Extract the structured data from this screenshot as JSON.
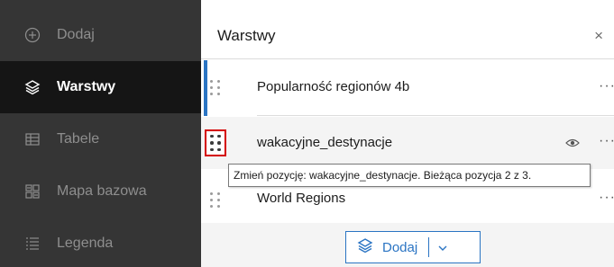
{
  "sidebar": {
    "items": [
      {
        "label": "Dodaj",
        "icon": "plus-circle-icon"
      },
      {
        "label": "Warstwy",
        "icon": "layers-icon"
      },
      {
        "label": "Tabele",
        "icon": "table-icon"
      },
      {
        "label": "Mapa bazowa",
        "icon": "basemap-icon"
      },
      {
        "label": "Legenda",
        "icon": "legend-icon"
      }
    ]
  },
  "panel": {
    "title": "Warstwy",
    "close_label": "×",
    "layers": [
      {
        "name": "Popularność regionów 4b",
        "more": "···"
      },
      {
        "name": "wakacyjne_destynacje",
        "more": "···"
      },
      {
        "name": "World Regions",
        "more": "···"
      }
    ],
    "tooltip": "Zmień pozycję: wakacyjne_destynacje. Bieżąca pozycja 2 z 3.",
    "add_button": {
      "label": "Dodaj"
    }
  },
  "colors": {
    "sidebar_bg": "#353535",
    "sidebar_active_bg": "#151515",
    "accent": "#2a74c3",
    "highlight_border": "#d40000"
  }
}
